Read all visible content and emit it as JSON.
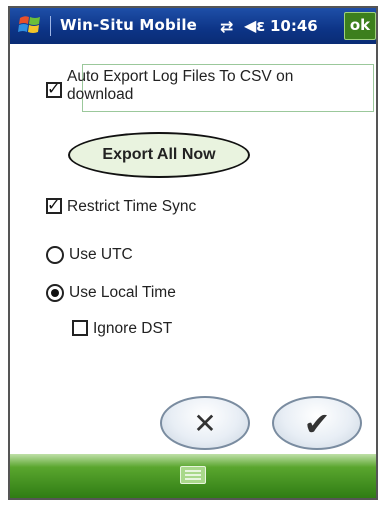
{
  "titlebar": {
    "app_title": "Win-Situ Mobile",
    "time": "10:46",
    "ok_label": "ok",
    "icons": [
      "windows-start-icon",
      "sync-icon",
      "volume-icon"
    ]
  },
  "options": {
    "auto_export_label": "Auto Export Log Files To CSV on download",
    "auto_export_checked": true,
    "export_button_label": "Export All Now",
    "restrict_time_sync_label": "Restrict Time Sync",
    "restrict_time_sync_checked": true,
    "use_utc_label": "Use UTC",
    "use_local_time_label": "Use Local Time",
    "time_mode_selected": "Use Local Time",
    "ignore_dst_label": "Ignore DST",
    "ignore_dst_checked": false
  },
  "buttons": {
    "cancel_icon": "x-icon",
    "confirm_icon": "checkmark-icon"
  },
  "colors": {
    "titlebar": "#0d3486",
    "ok_button": "#3c7f1d",
    "bottombar": "#2f7c14"
  }
}
